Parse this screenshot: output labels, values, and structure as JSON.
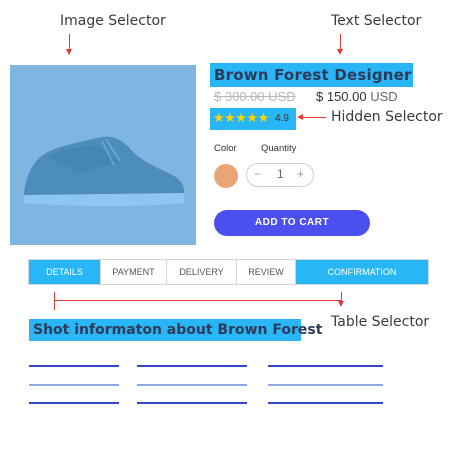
{
  "annotations": {
    "image_selector": "Image Selector",
    "text_selector": "Text Selector",
    "hidden_selector": "Hidden Selector",
    "table_selector": "Table Selector"
  },
  "product": {
    "title": "Brown Forest Designer",
    "old_price": "$ 300.00",
    "old_currency": "USD",
    "new_price": "$ 150.00",
    "new_currency": "USD",
    "stars": "★★★★★",
    "rating": "4.9",
    "color_label": "Color",
    "quantity_label": "Quantity",
    "quantity_value": "1",
    "minus": "−",
    "plus": "+",
    "add_to_cart": "ADD TO CART"
  },
  "tabs": [
    "DETAILS",
    "PAYMENT",
    "DELIVERY",
    "REVIEW",
    "CONFIRMATION"
  ],
  "active_tabs": [
    "DETAILS",
    "CONFIRMATION"
  ],
  "short_info": "Shot informaton about Brown Forest",
  "colors": {
    "highlight": "#29b6f6",
    "arrow": "#e53935",
    "button": "#4c4ff0",
    "swatch": "#e8a677",
    "line_dark": "#3545c8",
    "line_light": "#8fa8e8"
  }
}
